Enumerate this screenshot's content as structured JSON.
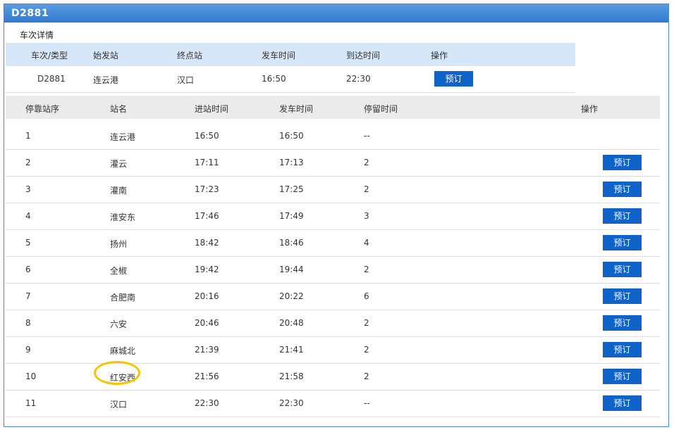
{
  "header": {
    "title": "D2881"
  },
  "detail": {
    "section_label": "车次详情"
  },
  "summary": {
    "columns": [
      "车次/类型",
      "始发站",
      "终点站",
      "发车时间",
      "到达时间",
      "操作"
    ],
    "row": {
      "train": "D2881",
      "origin": "连云港",
      "destination": "汉口",
      "depart": "16:50",
      "arrive": "22:30",
      "action": "预订"
    }
  },
  "stops": {
    "columns": [
      "停靠站序",
      "站名",
      "进站时间",
      "发车时间",
      "停留时间",
      "操作"
    ],
    "rows": [
      {
        "seq": "1",
        "station": "连云港",
        "arrive": "16:50",
        "depart": "16:50",
        "stay": "--",
        "action": ""
      },
      {
        "seq": "2",
        "station": "灌云",
        "arrive": "17:11",
        "depart": "17:13",
        "stay": "2",
        "action": "预订"
      },
      {
        "seq": "3",
        "station": "灌南",
        "arrive": "17:23",
        "depart": "17:25",
        "stay": "2",
        "action": "预订"
      },
      {
        "seq": "4",
        "station": "淮安东",
        "arrive": "17:46",
        "depart": "17:49",
        "stay": "3",
        "action": "预订"
      },
      {
        "seq": "5",
        "station": "扬州",
        "arrive": "18:42",
        "depart": "18:46",
        "stay": "4",
        "action": "预订"
      },
      {
        "seq": "6",
        "station": "全椒",
        "arrive": "19:42",
        "depart": "19:44",
        "stay": "2",
        "action": "预订"
      },
      {
        "seq": "7",
        "station": "合肥南",
        "arrive": "20:16",
        "depart": "20:22",
        "stay": "6",
        "action": "预订"
      },
      {
        "seq": "8",
        "station": "六安",
        "arrive": "20:46",
        "depart": "20:48",
        "stay": "2",
        "action": "预订"
      },
      {
        "seq": "9",
        "station": "麻城北",
        "arrive": "21:39",
        "depart": "21:41",
        "stay": "2",
        "action": "预订"
      },
      {
        "seq": "10",
        "station": "红安西",
        "arrive": "21:56",
        "depart": "21:58",
        "stay": "2",
        "action": "预订"
      },
      {
        "seq": "11",
        "station": "汉口",
        "arrive": "22:30",
        "depart": "22:30",
        "stay": "--",
        "action": "预订"
      }
    ]
  },
  "colors": {
    "title_bar": "#2f7ad1",
    "summary_header": "#d6e7fa",
    "button": "#0f63c8",
    "annotation": "#f5c400"
  }
}
